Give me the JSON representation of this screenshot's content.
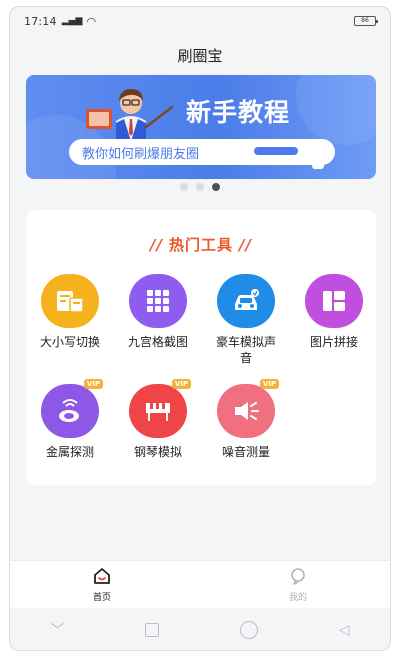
{
  "status": {
    "time": "17:14",
    "signal": "4G",
    "battery": "86"
  },
  "app": {
    "title": "刷圈宝"
  },
  "banner": {
    "title": "新手教程",
    "subtitle": "教你如何刷爆朋友圈"
  },
  "section": {
    "title": "热门工具",
    "deco": "//"
  },
  "tools": [
    {
      "label": "大小写切换",
      "icon": "text-icon",
      "color": "#f6b21c",
      "vip": ""
    },
    {
      "label": "九宫格截图",
      "icon": "grid-icon",
      "color": "#8f5cf0",
      "vip": ""
    },
    {
      "label": "豪车模拟声音",
      "icon": "car-icon",
      "color": "#1f8de8",
      "vip": ""
    },
    {
      "label": "图片拼接",
      "icon": "collage-icon",
      "color": "#c04fe0",
      "vip": ""
    },
    {
      "label": "金属探测",
      "icon": "detector-icon",
      "color": "#8e58e6",
      "vip": "VIP"
    },
    {
      "label": "钢琴模拟",
      "icon": "piano-icon",
      "color": "#f04548",
      "vip": "VIP"
    },
    {
      "label": "噪音测量",
      "icon": "speaker-icon",
      "color": "#f07080",
      "vip": "VIP"
    }
  ],
  "tabs": [
    {
      "label": "首页",
      "icon": "home-icon",
      "active": true
    },
    {
      "label": "我的",
      "icon": "profile-icon",
      "active": false
    }
  ],
  "colors": {
    "accent": "#f0572b",
    "banner": "#4b7ce8",
    "active_tab": "#222222",
    "inactive_tab": "#b0b4bc"
  }
}
